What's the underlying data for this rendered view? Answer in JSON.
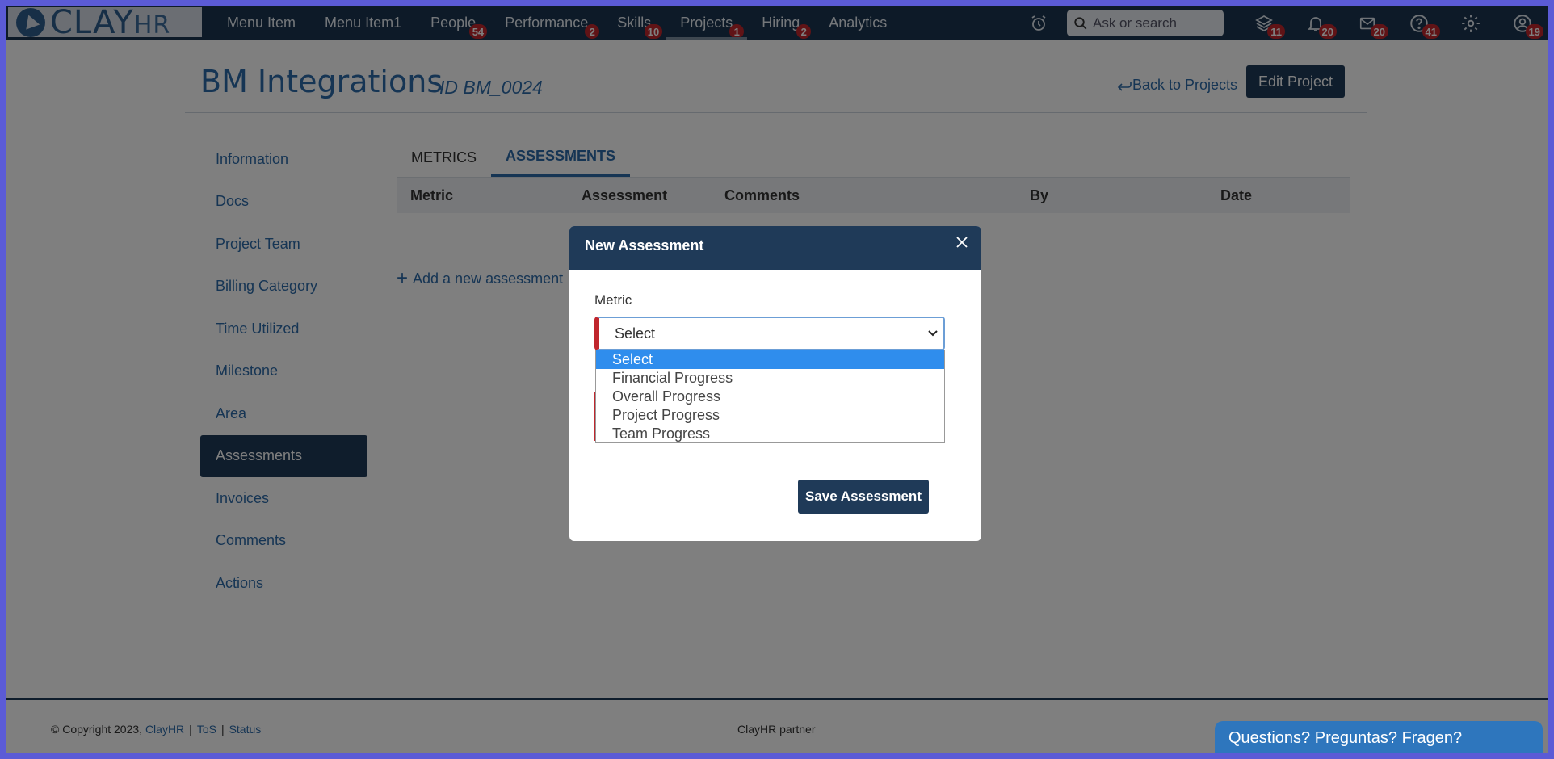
{
  "nav": {
    "logo": {
      "clay": "CLAY",
      "hr": "HR"
    },
    "items": [
      {
        "label": "Menu Item",
        "badge": ""
      },
      {
        "label": "Menu Item1",
        "badge": ""
      },
      {
        "label": "People",
        "badge": "54"
      },
      {
        "label": "Performance",
        "badge": "2"
      },
      {
        "label": "Skills",
        "badge": "10"
      },
      {
        "label": "Projects",
        "badge": "1"
      },
      {
        "label": "Hiring",
        "badge": "2"
      },
      {
        "label": "Analytics",
        "badge": ""
      }
    ],
    "search_placeholder": "Ask or search",
    "icon_badges": {
      "layers": "11",
      "bell": "20",
      "mail": "20",
      "help": "41",
      "profile": "19"
    }
  },
  "page": {
    "title": "BM Integrations",
    "id": "ID BM_0024",
    "back_label": "Back to Projects",
    "edit_label": "Edit Project"
  },
  "sidebar": {
    "items": [
      "Information",
      "Docs",
      "Project Team",
      "Billing Category",
      "Time Utilized",
      "Milestone",
      "Area",
      "Assessments",
      "Invoices",
      "Comments",
      "Actions"
    ],
    "active": "Assessments"
  },
  "tabs": [
    "METRICS",
    "ASSESSMENTS"
  ],
  "table": {
    "columns": [
      "Metric",
      "Assessment",
      "Comments",
      "By",
      "Date"
    ]
  },
  "add_label": "Add a new assessment",
  "footer": {
    "copyright": "© Copyright 2023,",
    "brand": "ClayHR",
    "tos": "ToS",
    "status": "Status",
    "partner": "ClayHR partner",
    "chat": "Questions? Preguntas? Fragen?"
  },
  "modal": {
    "title": "New Assessment",
    "metric_label": "Metric",
    "selected": "Select",
    "options": [
      "Select",
      "Financial Progress",
      "Overall Progress",
      "Project Progress",
      "Team Progress"
    ],
    "save_label": "Save Assessment"
  },
  "colors": {
    "navbar": "#1b3550",
    "primary": "#1f3a58",
    "link": "#2c6aa9",
    "badge": "#c0262d",
    "highlight": "#2f8ded"
  }
}
